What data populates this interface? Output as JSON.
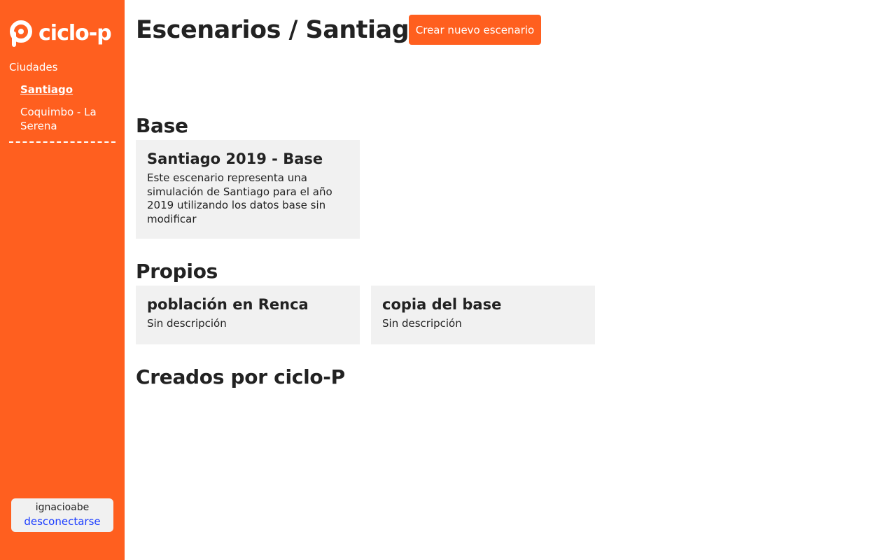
{
  "brand": {
    "name": "ciclo-p",
    "color": "#ff5f1f"
  },
  "sidebar": {
    "cities_label": "Ciudades",
    "cities": [
      {
        "label": "Santiago",
        "active": true
      },
      {
        "label": "Coquimbo - La Serena",
        "active": false
      }
    ],
    "user": {
      "name": "ignacioabe",
      "logout_label": "desconectarse"
    }
  },
  "header": {
    "title": "Escenarios / Santiago",
    "create_button_label": "Crear nuevo escenario"
  },
  "sections": [
    {
      "title": "Base",
      "cards": [
        {
          "title": "Santiago 2019 - Base",
          "description": "Este escenario representa una simulación de Santiago para el año 2019 utilizando los datos base sin modificar"
        }
      ]
    },
    {
      "title": "Propios",
      "cards": [
        {
          "title": "población en Renca",
          "description": "Sin descripción"
        },
        {
          "title": "copia del base",
          "description": "Sin descripción"
        }
      ]
    },
    {
      "title": "Creados por ciclo-P",
      "cards": []
    }
  ]
}
